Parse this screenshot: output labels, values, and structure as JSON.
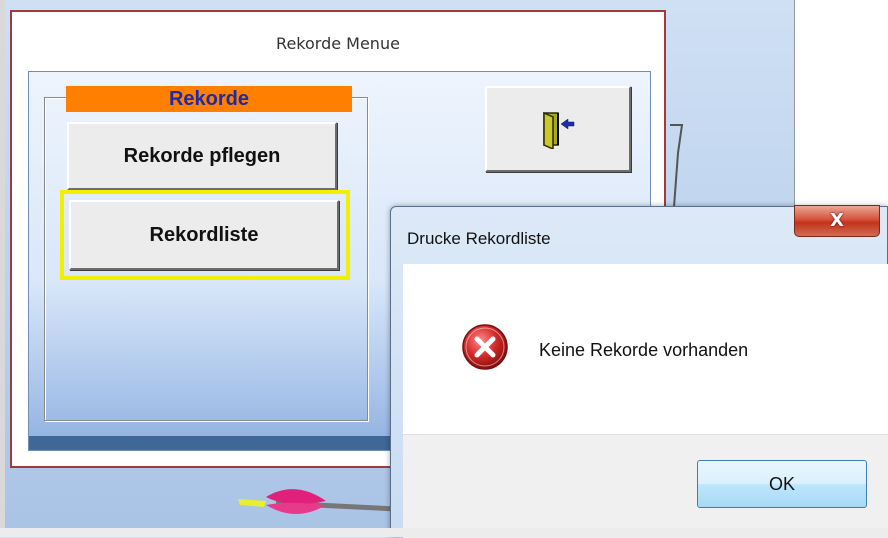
{
  "menu": {
    "title": "Rekorde Menue",
    "group_title": "Rekorde",
    "buttons": {
      "pflegen": "Rekorde pflegen",
      "liste": "Rekordliste"
    },
    "exit_icon": "exit-door-icon"
  },
  "dialog": {
    "title": "Drucke Rekordliste",
    "close_label": "X",
    "message": "Keine Rekorde vorhanden",
    "ok_label": "OK",
    "icon": "error-icon"
  },
  "colors": {
    "group_title_bg": "#ff8000",
    "group_title_text": "#1e2aa8",
    "highlight_frame": "#f2f000",
    "window_border": "#a23a3a",
    "error_red": "#c81e1e"
  }
}
